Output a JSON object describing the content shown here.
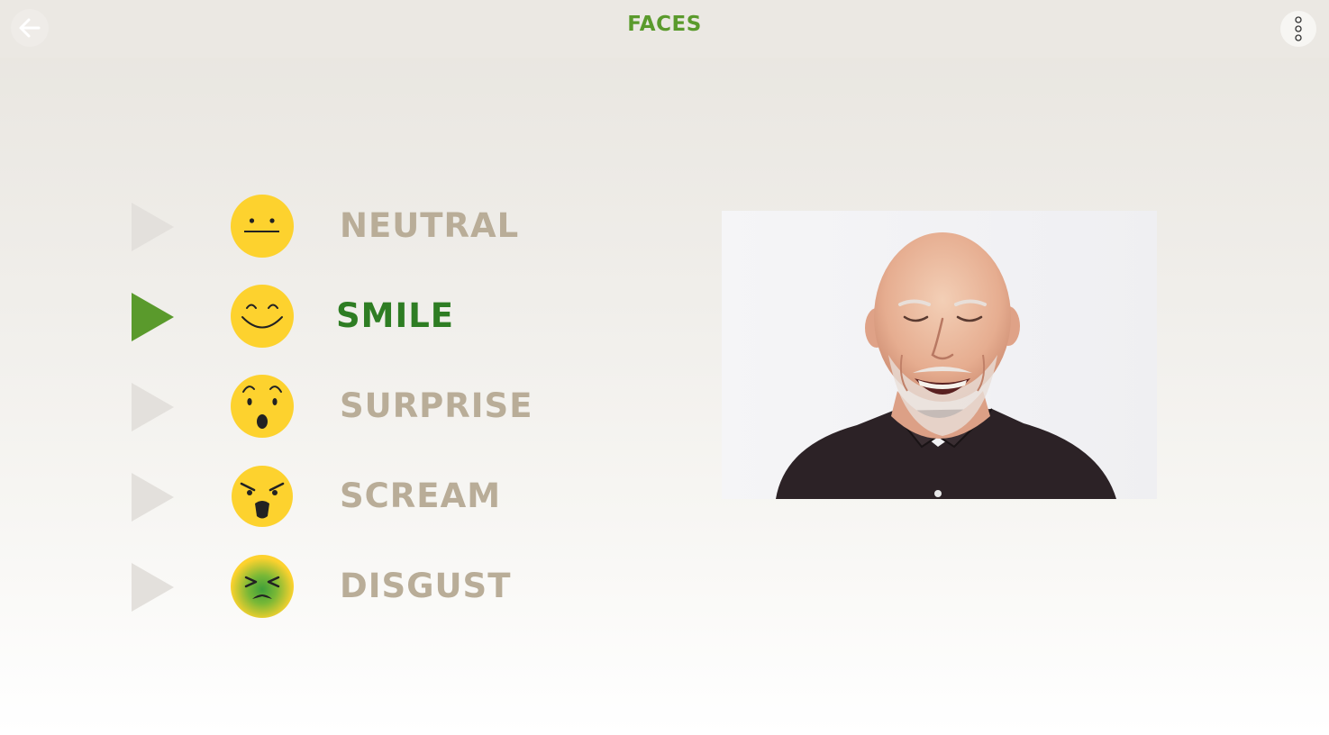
{
  "app": {
    "title": "FACES",
    "accent_color": "#5a9a2c",
    "active_label_color": "#2e7d23",
    "inactive_label_color": "#b9ad98"
  },
  "toolbar": {
    "back_icon": "arrow-left-icon",
    "menu_icon": "vertical-dots-icon"
  },
  "faces": [
    {
      "label": "NEUTRAL",
      "icon": "neutral-face-icon",
      "selected": false
    },
    {
      "label": "SMILE",
      "icon": "smile-face-icon",
      "selected": true
    },
    {
      "label": "SURPRISE",
      "icon": "surprise-face-icon",
      "selected": false
    },
    {
      "label": "SCREAM",
      "icon": "scream-face-icon",
      "selected": false
    },
    {
      "label": "DISGUST",
      "icon": "disgust-face-icon",
      "selected": false
    }
  ],
  "photo": {
    "subject": "smiling-elderly-man-photo"
  }
}
